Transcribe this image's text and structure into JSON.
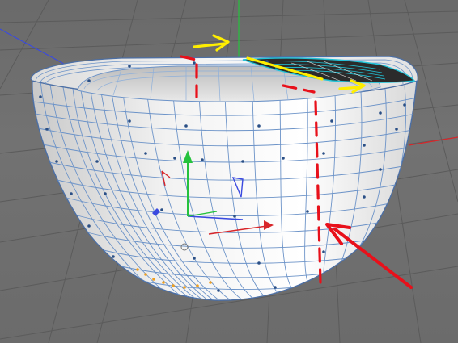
{
  "viewport": {
    "background_color": "#6f6f6f",
    "grid_color": "#5a5a5a",
    "mesh_line_color": "#6c93c8",
    "vertex_color": "#2a4f86",
    "selected_vertex_color": "#f0a020",
    "annotation_red": "#e8101a",
    "annotation_yellow": "#ffee00",
    "axis_x_color": "#d8262a",
    "axis_y_color": "#25c23d",
    "axis_z_color": "#3a4ae0"
  },
  "icons": {
    "world_axis": "world-axis-icon",
    "object_gizmo": "move-gizmo-icon",
    "annotation_arrows": "arrow-icon"
  }
}
